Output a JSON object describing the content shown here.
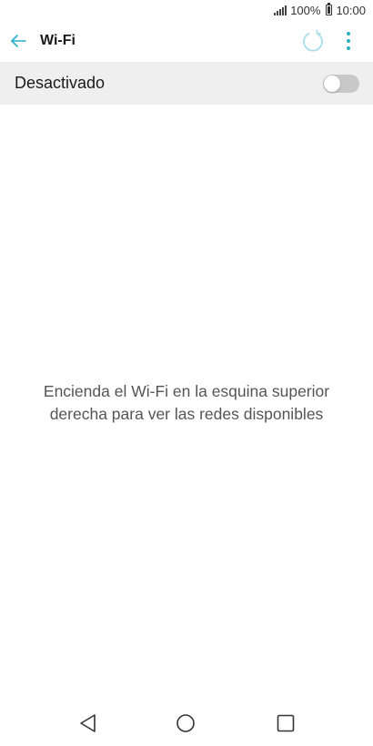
{
  "status_bar": {
    "battery_level": "100%",
    "time": "10:00",
    "icons": [
      "signal-icon",
      "battery-icon"
    ]
  },
  "app_bar": {
    "title": "Wi-Fi",
    "icons": [
      "back-arrow-icon",
      "refresh-icon",
      "more-options-icon"
    ]
  },
  "wifi_toggle": {
    "label": "Desactivado",
    "enabled": false
  },
  "empty_state": {
    "line1": "Encienda el Wi-Fi en la esquina superior",
    "line2": "derecha para ver las redes disponibles"
  },
  "navigation_bar": {
    "icons": [
      "nav-back-icon",
      "nav-home-icon",
      "nav-recents-icon"
    ]
  },
  "colors": {
    "accent": "#26b1c9",
    "toggle_row_bg": "#efefef",
    "switch_off": "#c8c8c8",
    "text_primary": "#1a1a1a",
    "text_secondary": "#555555"
  }
}
